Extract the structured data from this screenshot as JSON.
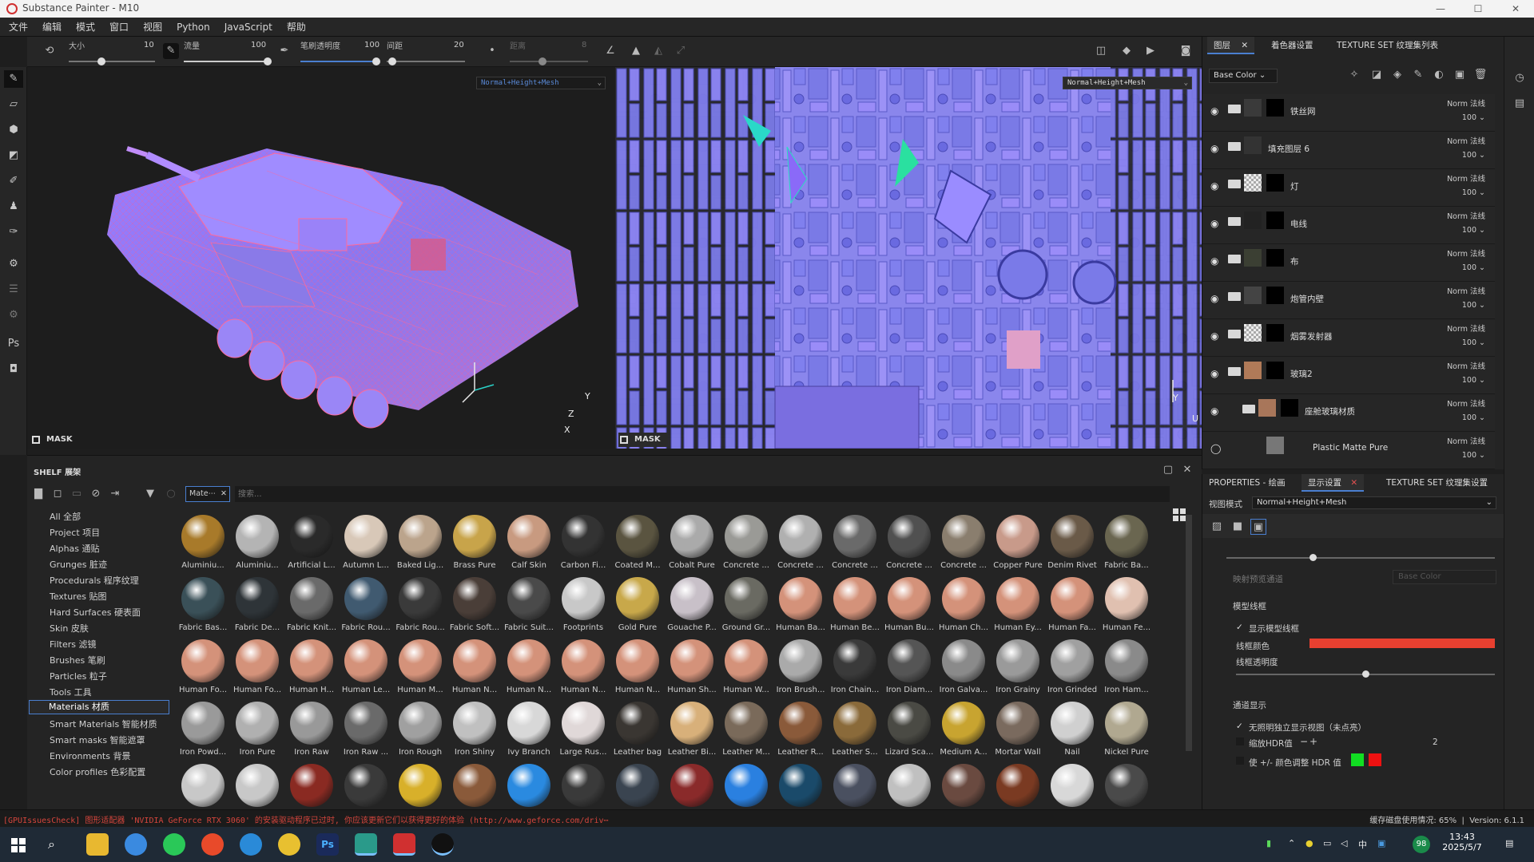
{
  "window": {
    "title": "Substance Painter - M10",
    "minimize": "—",
    "maximize": "☐",
    "close": "✕"
  },
  "menu": [
    "文件",
    "编辑",
    "模式",
    "窗口",
    "视图",
    "Python",
    "JavaScript",
    "帮助"
  ],
  "toolbar": {
    "size_label": "大小",
    "size_value": "10",
    "flow_label": "流量",
    "flow_value": "100",
    "stroke_opacity_label": "笔刷透明度",
    "stroke_opacity_value": "100",
    "spacing_label": "间距",
    "spacing_value": "20",
    "distance_label": "距离",
    "distance_value": "8"
  },
  "viewport3d": {
    "mode": "Normal+Height+Mesh",
    "mask_label": "MASK",
    "axis_y": "Y",
    "axis_z": "Z",
    "axis_x": "X"
  },
  "viewport2d": {
    "mode": "Normal+Height+Mesh",
    "mask_label": "MASK",
    "axis_y": "Y",
    "axis_u": "U"
  },
  "layers_panel": {
    "tabs": [
      "图层",
      "着色器设置",
      "TEXTURE SET 纹理集列表"
    ],
    "channel": "Base Color",
    "layers": [
      {
        "name": "铁丝网",
        "blend": "Norm 法线",
        "opacity": "100",
        "thumb": "#3a3a3a"
      },
      {
        "name": "填充图层 6",
        "blend": "Norm 法线",
        "opacity": "100",
        "thumb": "#333"
      },
      {
        "name": "灯",
        "blend": "Norm 法线",
        "opacity": "100",
        "thumb": "checker"
      },
      {
        "name": "电线",
        "blend": "Norm 法线",
        "opacity": "100",
        "thumb": "#222"
      },
      {
        "name": "布",
        "blend": "Norm 法线",
        "opacity": "100",
        "thumb": "#3b3f33"
      },
      {
        "name": "炮管内壁",
        "blend": "Norm 法线",
        "opacity": "100",
        "thumb": "#444"
      },
      {
        "name": "烟雾发射器",
        "blend": "Norm 法线",
        "opacity": "100",
        "thumb": "checker"
      },
      {
        "name": "玻璃2",
        "blend": "Norm 法线",
        "opacity": "100",
        "thumb": "#b07a58"
      },
      {
        "name": "座舱玻璃材质",
        "blend": "Norm 法线",
        "opacity": "100",
        "thumb": "#a8765a"
      },
      {
        "name": "Plastic Matte Pure",
        "blend": "Norm 法线",
        "opacity": "100",
        "thumb": "#777"
      }
    ]
  },
  "properties_panel": {
    "tabs": [
      "PROPERTIES - 绘画",
      "显示设置",
      "TEXTURE SET 纹理集设置"
    ],
    "view_mode_label": "视图模式",
    "view_mode_value": "Normal+Height+Mesh",
    "mapping_label": "映射预览通道",
    "mapping_value": "Base Color",
    "wireframe_section": "模型线框",
    "show_wireframe": "显示模型线框",
    "wire_color_label": "线框颜色",
    "wire_opacity_label": "线框透明度",
    "channel_section": "通道显示",
    "isolate_label": "无照明独立显示视图（未点亮）",
    "hdr_scale_label": "缩放HDR值",
    "hdr_scale_value": "2",
    "hdr_color_label": "使 +/- 颜色调整 HDR 值",
    "wire_opacity_fraction": 0.5
  },
  "shelf": {
    "title": "SHELF 展架",
    "filter_tag": "Mate⋯",
    "search_placeholder": "搜索...",
    "categories": [
      "All 全部",
      "Project 项目",
      "Alphas 通贴",
      "Grunges 脏迹",
      "Procedurals 程序纹理",
      "Textures 贴图",
      "Hard Surfaces 硬表面",
      "Skin 皮肤",
      "Filters 滤镜",
      "Brushes 笔刷",
      "Particles 粒子",
      "Tools 工具",
      "Materials 材质",
      "Smart Materials 智能材质",
      "Smart masks 智能遮罩",
      "Environments 背景",
      "Color profiles 色彩配置"
    ],
    "selected_category": 12,
    "materials": [
      [
        "Aluminiu...",
        "#a87a2a"
      ],
      [
        "Aluminiu...",
        "#b4b4b4"
      ],
      [
        "Artificial L...",
        "#2a2a2a"
      ],
      [
        "Autumn L...",
        "#d8c8b8"
      ],
      [
        "Baked Lig...",
        "#bba48c"
      ],
      [
        "Brass Pure",
        "#c8a44a"
      ],
      [
        "Calf Skin",
        "#c89a80"
      ],
      [
        "Carbon Fi...",
        "#333"
      ],
      [
        "Coated M...",
        "#5a5440"
      ],
      [
        "Cobalt Pure",
        "#aaaaaa"
      ],
      [
        "Concrete ...",
        "#9a9a96"
      ],
      [
        "Concrete ...",
        "#b0b0b0"
      ],
      [
        "Concrete ...",
        "#6a6a6a"
      ],
      [
        "Concrete ...",
        "#505050"
      ],
      [
        "Concrete ...",
        "#8a7e6e"
      ],
      [
        "Copper Pure",
        "#c89a8a"
      ],
      [
        "Denim Rivet",
        "#6a5a48"
      ],
      [
        "Fabric Ba...",
        "#6a6650"
      ],
      [
        "Fabric Bas...",
        "#3a5058"
      ],
      [
        "Fabric De...",
        "#2e3438"
      ],
      [
        "Fabric Knit...",
        "#6a6a6a"
      ],
      [
        "Fabric Rou...",
        "#405a70"
      ],
      [
        "Fabric Rou...",
        "#3a3a3a"
      ],
      [
        "Fabric Soft...",
        "#4a3e38"
      ],
      [
        "Fabric Suit...",
        "#4a4a4a"
      ],
      [
        "Footprints",
        "#c8c8c8"
      ],
      [
        "Gold Pure",
        "#c8a84a"
      ],
      [
        "Gouache P...",
        "#c8c0c8"
      ],
      [
        "Ground Gr...",
        "#6a6a62"
      ],
      [
        "Human Ba...",
        "#d4927a"
      ],
      [
        "Human Be...",
        "#d4927a"
      ],
      [
        "Human Bu...",
        "#d4927a"
      ],
      [
        "Human Ch...",
        "#d4927a"
      ],
      [
        "Human Ey...",
        "#d4927a"
      ],
      [
        "Human Fa...",
        "#d4927a"
      ],
      [
        "Human Fe...",
        "#e0c0b0"
      ],
      [
        "Human Fo...",
        "#d4927a"
      ],
      [
        "Human Fo...",
        "#d4927a"
      ],
      [
        "Human H...",
        "#d4927a"
      ],
      [
        "Human Le...",
        "#d4927a"
      ],
      [
        "Human M...",
        "#d4927a"
      ],
      [
        "Human N...",
        "#d4927a"
      ],
      [
        "Human N...",
        "#d4927a"
      ],
      [
        "Human N...",
        "#d4927a"
      ],
      [
        "Human N...",
        "#d4927a"
      ],
      [
        "Human Sh...",
        "#d4927a"
      ],
      [
        "Human W...",
        "#d4927a"
      ],
      [
        "Iron Brush...",
        "#aaaaaa"
      ],
      [
        "Iron Chain...",
        "#3a3a3a"
      ],
      [
        "Iron Diam...",
        "#555"
      ],
      [
        "Iron Galva...",
        "#8a8a8a"
      ],
      [
        "Iron Grainy",
        "#9a9a9a"
      ],
      [
        "Iron Grinded",
        "#a0a0a0"
      ],
      [
        "Iron Ham...",
        "#8a8a8a"
      ],
      [
        "Iron Powd...",
        "#9a9a9a"
      ],
      [
        "Iron Pure",
        "#b0b0b0"
      ],
      [
        "Iron Raw",
        "#999"
      ],
      [
        "Iron Raw ...",
        "#6a6a6a"
      ],
      [
        "Iron Rough",
        "#a0a0a0"
      ],
      [
        "Iron Shiny",
        "#c0c0c0"
      ],
      [
        "Ivy Branch",
        "#d8d8d8"
      ],
      [
        "Large Rus...",
        "#e0d8d8"
      ],
      [
        "Leather bag",
        "#3a3632"
      ],
      [
        "Leather Bi...",
        "#d8b07a"
      ],
      [
        "Leather M...",
        "#7a6a5a"
      ],
      [
        "Leather R...",
        "#8a5a3a"
      ],
      [
        "Leather S...",
        "#8a6a3a"
      ],
      [
        "Lizard Sca...",
        "#4a4a44"
      ],
      [
        "Medium A...",
        "#c8a430"
      ],
      [
        "Mortar Wall",
        "#7a6a5e"
      ],
      [
        "Nail",
        "#d0d0d0"
      ],
      [
        "Nickel Pure",
        "#b0a890"
      ],
      [
        "",
        "#c8c8c8"
      ],
      [
        "",
        "#c8c8c8"
      ],
      [
        "",
        "#8a2a22"
      ],
      [
        "",
        "#3a3a3a"
      ],
      [
        "",
        "#d8b02a"
      ],
      [
        "",
        "#8a5a3a"
      ],
      [
        "",
        "#2a8ae0"
      ],
      [
        "",
        "#3a3a3a"
      ],
      [
        "",
        "#3a4450"
      ],
      [
        "",
        "#8a2a2a"
      ],
      [
        "",
        "#2a80e0"
      ],
      [
        "",
        "#1a4a6a"
      ],
      [
        "",
        "#4a5060"
      ],
      [
        "",
        "#c0c0c0"
      ],
      [
        "",
        "#6a4a40"
      ],
      [
        "",
        "#7a3a22"
      ],
      [
        "",
        "#d8d8d8"
      ],
      [
        "",
        "#4a4a4a"
      ]
    ]
  },
  "status": {
    "warning": "[GPUIssuesCheck] 图形适配器 'NVIDIA GeForce RTX 3060' 的安装驱动程序已过时, 你应该更新它们以获得更好的体验 (http://www.geforce.com/driv⋯",
    "cache": "缓存磁盘使用情况: 65%",
    "version": "Version: 6.1.1"
  },
  "taskbar": {
    "time": "13:43",
    "date": "2025/5/7",
    "ime": "中",
    "badge": "98"
  },
  "colors": {
    "accent": "#4a7fd0",
    "wire": "#e84030",
    "green": "#11dd22",
    "red": "#ee1111"
  }
}
